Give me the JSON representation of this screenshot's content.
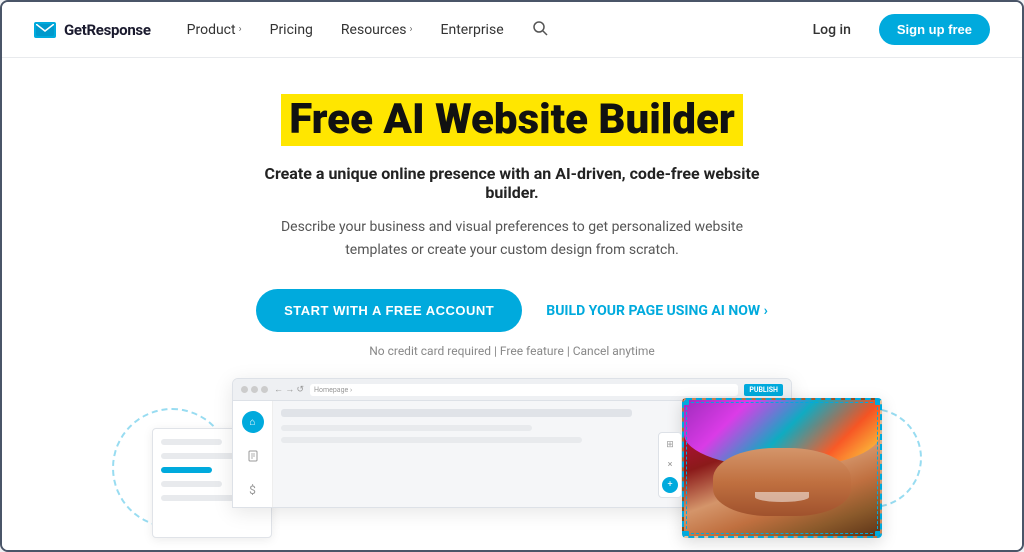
{
  "meta": {
    "title": "Free AI Website Builder - GetResponse"
  },
  "nav": {
    "logo_text": "GetResponse",
    "items": [
      {
        "label": "Product",
        "has_chevron": true
      },
      {
        "label": "Pricing",
        "has_chevron": false
      },
      {
        "label": "Resources",
        "has_chevron": true
      },
      {
        "label": "Enterprise",
        "has_chevron": false
      }
    ],
    "login_label": "Log in",
    "signup_label": "Sign up free"
  },
  "hero": {
    "title": "Free AI Website Builder",
    "subtitle": "Create a unique online presence with an AI-driven, code-free website builder.",
    "description": "Describe your business and visual preferences to get personalized website templates or create your custom design from scratch.",
    "cta_primary": "START WITH A FREE ACCOUNT",
    "cta_secondary": "BUILD YOUR PAGE USING AI NOW ›",
    "disclaimer": "No credit card required | Free feature | Cancel anytime"
  },
  "preview": {
    "url_text": "Homepage ›",
    "publish_label": "PUBLISH"
  },
  "colors": {
    "accent": "#00aadd",
    "highlight": "#FFE600",
    "text_dark": "#111111",
    "text_muted": "#888888"
  }
}
